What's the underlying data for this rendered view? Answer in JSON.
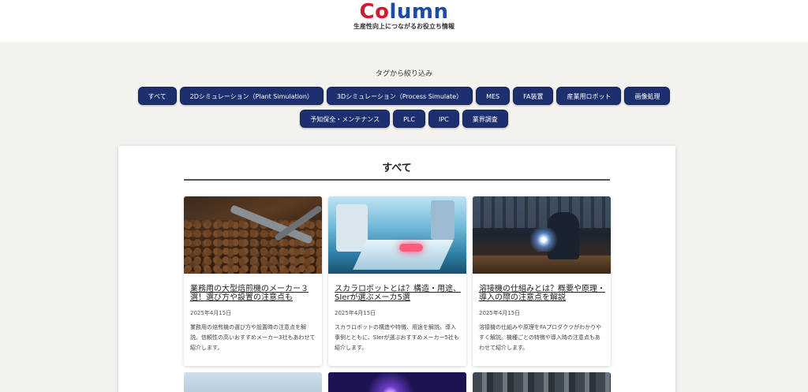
{
  "header": {
    "logo_part1": "Co",
    "logo_part2": "lumn",
    "tagline": "生産性向上につながるお役立ち情報"
  },
  "filter": {
    "title": "タグから絞り込み",
    "tags_row1": [
      "すべて",
      "2Dシミュレーション（Plant Simulation）",
      "3Dシミュレーション（Process Simulate）",
      "MES",
      "FA装置",
      "産業用ロボット",
      "画像処理"
    ],
    "tags_row2": [
      "予知保全・メンテナンス",
      "PLC",
      "IPC",
      "業界調査"
    ]
  },
  "section": {
    "title": "すべて"
  },
  "articles": [
    {
      "title": "業務用の大型焙煎機のメーカー３選！選び方や設置の注意点も",
      "date": "2025年4月15日",
      "description": "業務用の焙煎機の選び方や設置時の注意点を解説。信頼性の高いおすすめメーカー3社もあわせて紹介します。",
      "image": "coffee-roaster-image"
    },
    {
      "title": "スカラロボットとは？構造・用途、SIerが選ぶメーカ5選",
      "date": "2025年4月15日",
      "description": "スカラロボットの構造や特徴、用途を解説。導入事例とともに、SIerが選ぶおすすめメーカー5社も紹介します。",
      "image": "scara-robot-image"
    },
    {
      "title": "溶接機の仕組みとは？概要や原理・導入の際の注意点を解説",
      "date": "2025年4月15日",
      "description": "溶接機の仕組みや原理をFAプロダクツがわかりやすく解説。機種ごとの特徴や導入時の注意点もあわせて紹介します。",
      "image": "welding-image"
    }
  ],
  "colors": {
    "tag_bg": "#1d2f6f",
    "logo_red": "#d5182b",
    "logo_blue": "#1e4aa2",
    "page_bg": "#f4f2ee"
  }
}
